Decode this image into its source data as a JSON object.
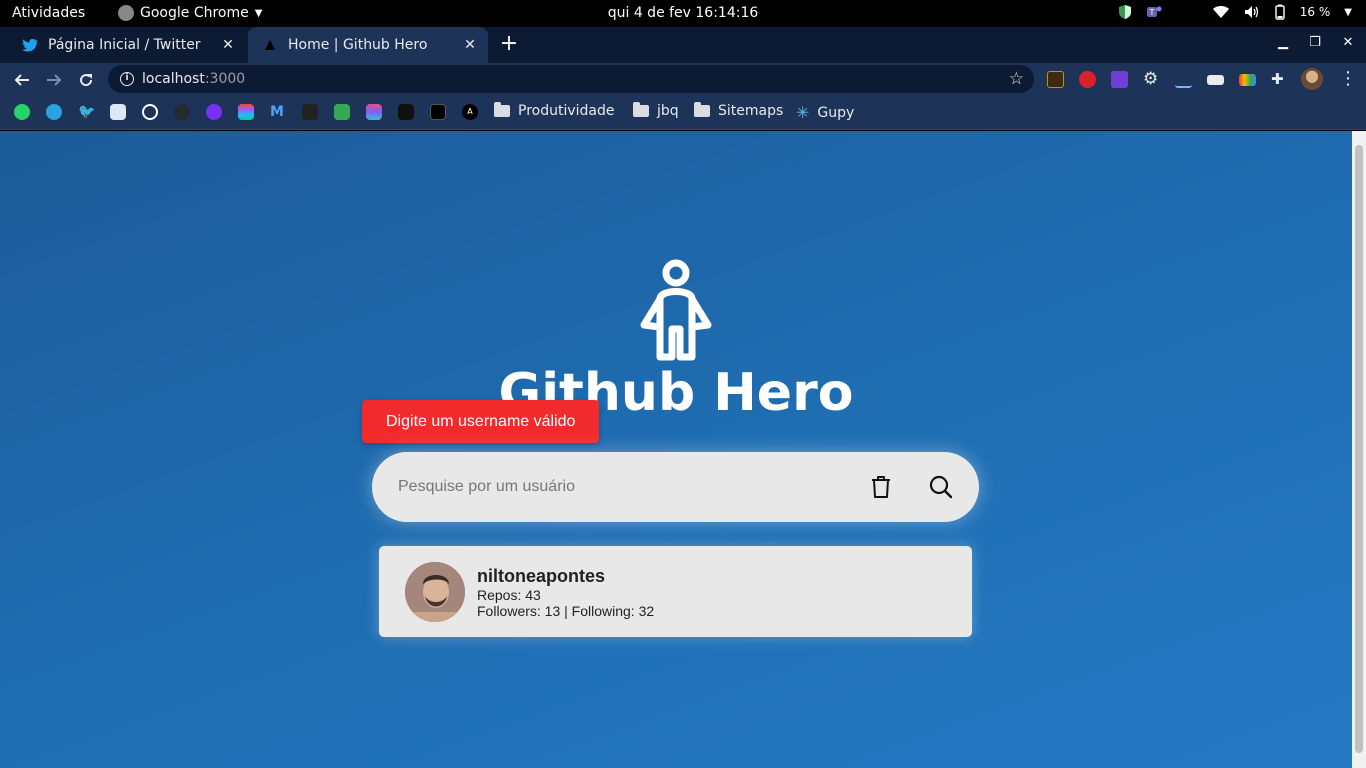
{
  "topbar": {
    "activities": "Atividades",
    "app_name": "Google Chrome",
    "clock": "qui 4 de fev  16:14:16",
    "battery": "16 %"
  },
  "tabs": [
    {
      "title": "Página Inicial / Twitter",
      "icon": "twitter-icon",
      "active": false
    },
    {
      "title": "Home | Github Hero",
      "icon": "vercel-icon",
      "active": true
    }
  ],
  "address": {
    "host": "localhost",
    "port": ":3000"
  },
  "bookmarks": {
    "folders": [
      "Produtividade",
      "jbq",
      "Sitemaps"
    ],
    "gupy": "Gupy"
  },
  "page": {
    "title": "Github Hero",
    "toast": "Digite um username válido",
    "search_placeholder": "Pesquise por um usuário",
    "search_value": "",
    "user": {
      "login": "niltoneapontes",
      "repos": "Repos: 43",
      "follow": "Followers: 13 | Following: 32"
    }
  },
  "colors": {
    "toast": "#f12b2b",
    "background_start": "#1d5b99",
    "background_end": "#2478c3",
    "card": "#e8e8e8"
  }
}
